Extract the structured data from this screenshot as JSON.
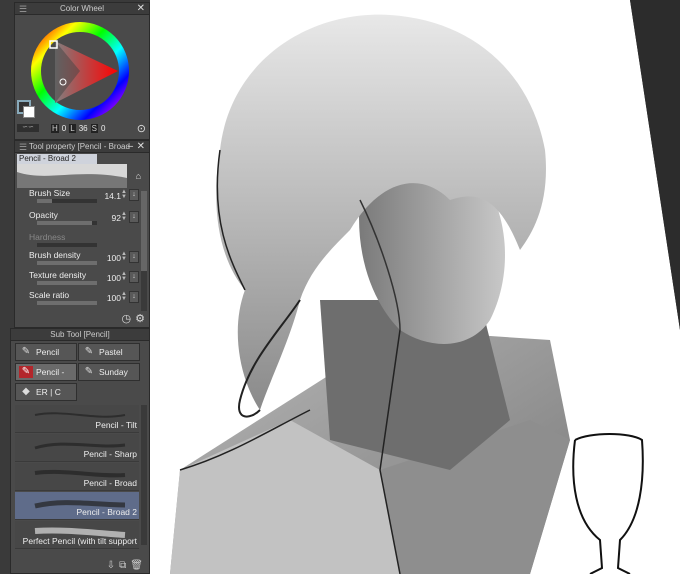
{
  "color_wheel": {
    "title": "Color Wheel",
    "h_key": "H",
    "h_val": "0",
    "l_key": "L",
    "l_val": "36",
    "s_key": "S",
    "s_val": "0"
  },
  "tool_property": {
    "title": "Tool property [Pencil - Broad",
    "preset": "Pencil - Broad 2",
    "rows": [
      {
        "label": "Brush Size",
        "value": "14.1",
        "fill": 0.25
      },
      {
        "label": "Opacity",
        "value": "92",
        "fill": 0.92
      },
      {
        "label": "Hardness",
        "value": "",
        "fill": 0
      },
      {
        "label": "Brush density",
        "value": "100",
        "fill": 1
      },
      {
        "label": "Texture density",
        "value": "100",
        "fill": 1
      },
      {
        "label": "Scale ratio",
        "value": "100",
        "fill": 1
      }
    ]
  },
  "sub_tool": {
    "title": "Sub Tool [Pencil]",
    "tabs": [
      "Pencil",
      "Pastel",
      "Pencil - Tilt",
      "Sunday",
      "ER | C"
    ],
    "brushes": [
      "Pencil - Tilt",
      "Pencil - Sharp",
      "Pencil - Broad",
      "Pencil - Broad 2",
      "Perfect Pencil (with tilt support"
    ]
  }
}
